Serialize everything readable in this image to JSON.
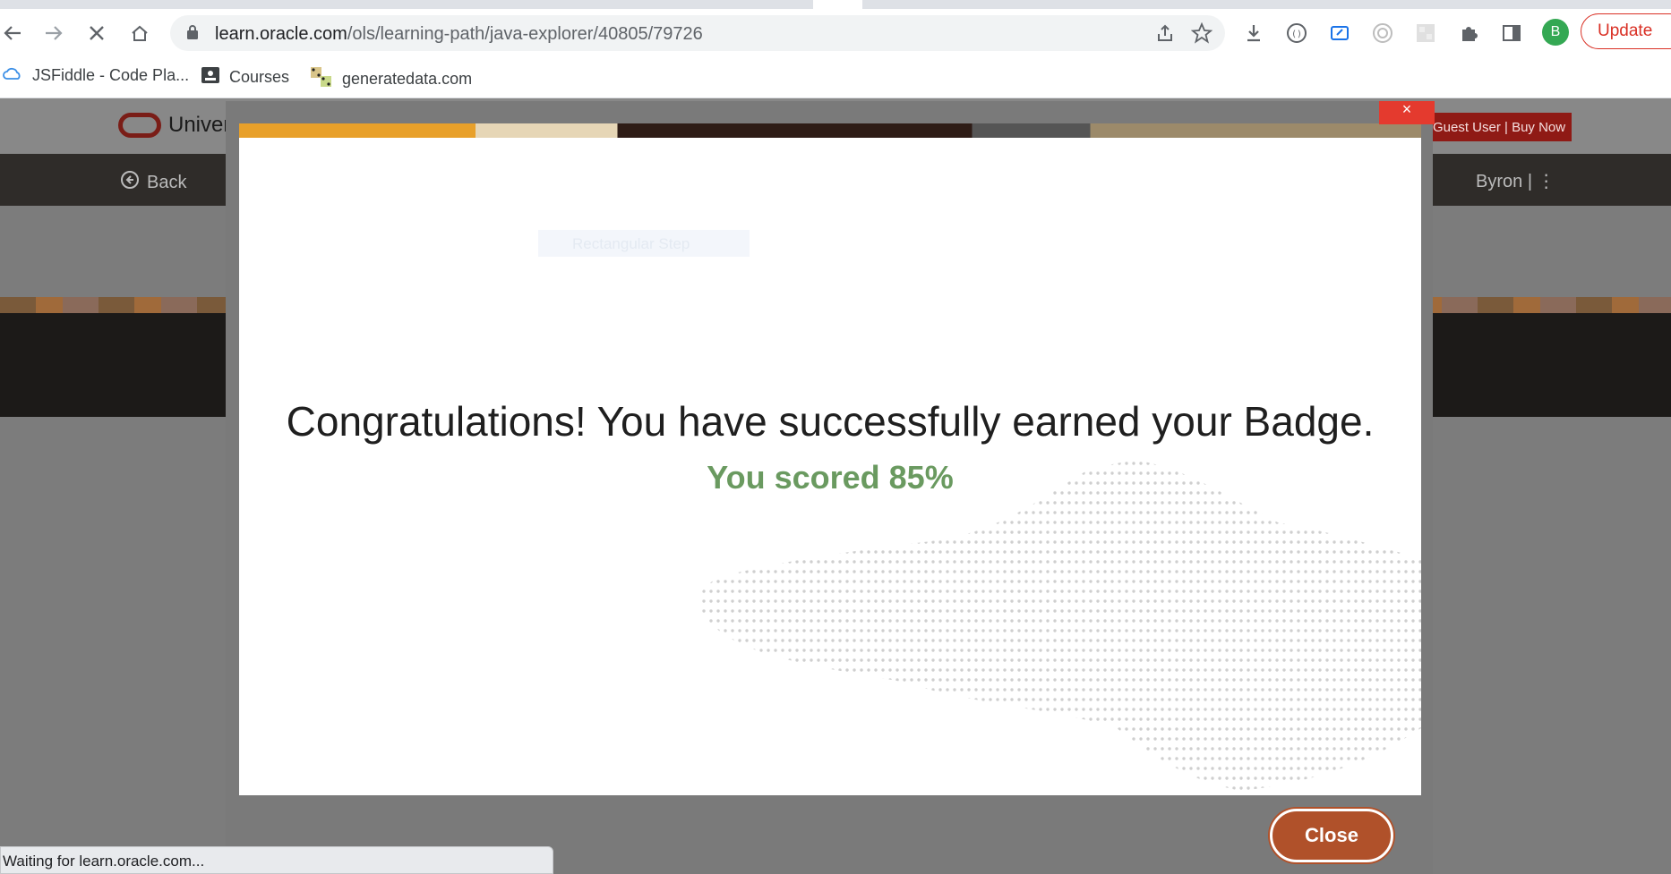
{
  "browser": {
    "url_host": "learn.oracle.com",
    "url_path": "/ols/learning-path/java-explorer/40805/79726",
    "update_label": "Update",
    "profile_initial": "B",
    "status_text": "Waiting for learn.oracle.com...",
    "bookmarks": [
      "JSFiddle - Code Pla...",
      "Courses",
      "generatedata.com"
    ]
  },
  "site": {
    "brand_text": "Univer",
    "guest_label": "Guest User | Buy Now",
    "back_label": "Back",
    "user_name": "Byron",
    "user_separator": "|"
  },
  "modal": {
    "ghost_step": "Rectangular Step",
    "congrats": "Congratulations! You have successfully earned your Badge.",
    "score": "You scored 85%",
    "close_label": "Close",
    "close_x": "×"
  },
  "colors": {
    "score_green": "#6a9a60",
    "close_button": "#b0512a",
    "guest_button": "#8f1a15"
  }
}
